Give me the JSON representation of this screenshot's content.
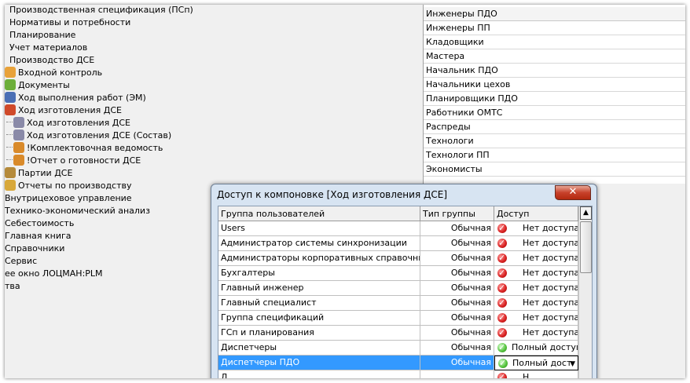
{
  "tree": {
    "items": [
      {
        "label": "Производственная спецификация (ПСп)",
        "icon": "folder-icon"
      },
      {
        "label": "Нормативы и потребности",
        "icon": "folder-icon"
      },
      {
        "label": "Планирование",
        "icon": "folder-icon"
      },
      {
        "label": "Учет материалов",
        "icon": "folder-icon"
      },
      {
        "label": "Производство ДСЕ",
        "icon": "folder-icon"
      },
      {
        "label": "Входной контроль",
        "icon": "user-check-icon"
      },
      {
        "label": "Документы",
        "icon": "documents-gear-icon"
      },
      {
        "label": "Ход выполнения работ (ЭМ)",
        "icon": "truck-icon"
      },
      {
        "label": "Ход изготовления ДСЕ",
        "icon": "process-icon"
      },
      {
        "label": "Ход изготовления ДСЕ",
        "icon": "layout-icon"
      },
      {
        "label": "Ход изготовления ДСЕ (Состав)",
        "icon": "layout-icon"
      },
      {
        "label": "!Комплектовочная ведомость",
        "icon": "report-icon"
      },
      {
        "label": "!Отчет о готовности ДСЕ",
        "icon": "report-icon"
      },
      {
        "label": "Партии ДСЕ",
        "icon": "parts-icon"
      },
      {
        "label": "Отчеты по производству",
        "icon": "reports-folder-icon"
      },
      {
        "label": "Внутрицеховое управление",
        "icon": "folder-icon"
      },
      {
        "label": "Технико-экономический анализ",
        "icon": "folder-icon"
      },
      {
        "label": "Себестоимость",
        "icon": "folder-icon"
      },
      {
        "label": "Главная книга",
        "icon": "folder-icon"
      },
      {
        "label": "Справочники",
        "icon": "folder-icon"
      },
      {
        "label": "Сервис",
        "icon": "folder-icon"
      },
      {
        "label": "ее окно ЛОЦМАН:PLM",
        "icon": "none"
      },
      {
        "label": "тва",
        "icon": "none"
      }
    ]
  },
  "right_list": {
    "items": [
      "Инженеры ПДО",
      "Инженеры ПП",
      "Кладовщики",
      "Мастера",
      "Начальник ПДО",
      "Начальники цехов",
      "Планировщики ПДО",
      "Работники ОМТС",
      "Распреды",
      "Технологи",
      "Технологи ПП",
      "Экономисты"
    ]
  },
  "dialog": {
    "title": "Доступ к компоновке [Ход изготовления ДСЕ]",
    "close_glyph": "✕",
    "columns": {
      "group": "Группа пользователей",
      "type": "Тип группы",
      "access": "Доступ"
    },
    "rows": [
      {
        "group": "Users",
        "type": "Обычная",
        "access": "Нет доступа",
        "status": "no"
      },
      {
        "group": "Администратор системы синхронизации",
        "type": "Обычная",
        "access": "Нет доступа",
        "status": "no"
      },
      {
        "group": "Администраторы корпоративных справочников",
        "type": "Обычная",
        "access": "Нет доступа",
        "status": "no"
      },
      {
        "group": "Бухгалтеры",
        "type": "Обычная",
        "access": "Нет доступа",
        "status": "no"
      },
      {
        "group": "Главный инженер",
        "type": "Обычная",
        "access": "Нет доступа",
        "status": "no"
      },
      {
        "group": "Главный специалист",
        "type": "Обычная",
        "access": "Нет доступа",
        "status": "no"
      },
      {
        "group": "Группа спецификаций",
        "type": "Обычная",
        "access": "Нет доступа",
        "status": "no"
      },
      {
        "group": "ГСп и планирования",
        "type": "Обычная",
        "access": "Нет доступа",
        "status": "no"
      },
      {
        "group": "Диспетчеры",
        "type": "Обычная",
        "access": "Полный доступ",
        "status": "full"
      },
      {
        "group": "Диспетчеры ПДО",
        "type": "Обычная",
        "access": "Полный дост",
        "status": "full",
        "selected": true
      },
      {
        "group": "Д",
        "type": "",
        "access": "Н",
        "status": "no"
      }
    ],
    "dropdown_arrow": "▼",
    "scroll_up": "▲"
  },
  "colors": {
    "selection": "#3399ff",
    "no_access": "#d81f1f",
    "full_access": "#52c23a",
    "close_button": "#c7412b"
  }
}
